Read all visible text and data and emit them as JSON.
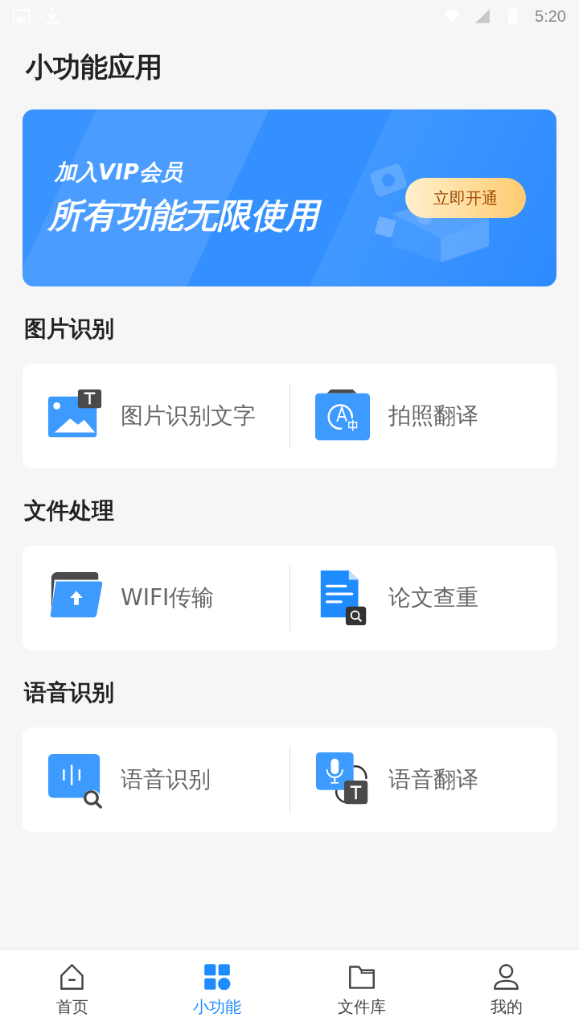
{
  "status_bar": {
    "time": "5:20"
  },
  "page_title": "小功能应用",
  "banner": {
    "subtitle": "加入VIP会员",
    "headline": "所有功能无限使用",
    "button": "立即开通"
  },
  "sections": [
    {
      "title": "图片识别",
      "items": [
        {
          "kind": "image-text",
          "label": "图片识别文字"
        },
        {
          "kind": "photo-translate",
          "label": "拍照翻译"
        }
      ]
    },
    {
      "title": "文件处理",
      "items": [
        {
          "kind": "wifi-upload",
          "label": "WIFI传输"
        },
        {
          "kind": "doc-check",
          "label": "论文查重"
        }
      ]
    },
    {
      "title": "语音识别",
      "items": [
        {
          "kind": "voice-search",
          "label": "语音识别"
        },
        {
          "kind": "voice-translate",
          "label": "语音翻译"
        }
      ]
    }
  ],
  "tabs": [
    {
      "kind": "home",
      "label": "首页",
      "selected": false
    },
    {
      "kind": "tools",
      "label": "小功能",
      "selected": true
    },
    {
      "kind": "folder",
      "label": "文件库",
      "selected": false
    },
    {
      "kind": "user",
      "label": "我的",
      "selected": false
    }
  ]
}
